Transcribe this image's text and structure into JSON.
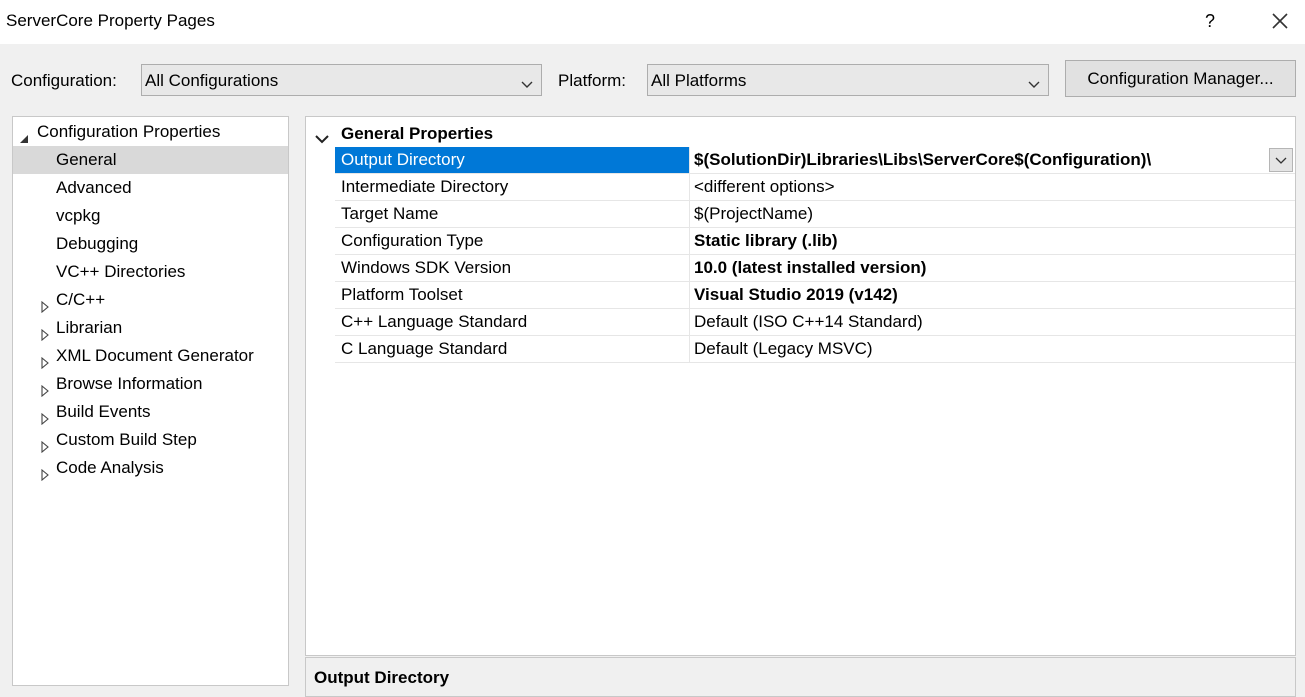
{
  "window": {
    "title": "ServerCore Property Pages",
    "help": "?"
  },
  "toolbar": {
    "configuration_label": "Configuration:",
    "configuration_value": "All Configurations",
    "platform_label": "Platform:",
    "platform_value": "All Platforms",
    "config_manager_label": "Configuration Manager..."
  },
  "tree": {
    "items": [
      {
        "label": "Configuration Properties",
        "expander": "expanded"
      },
      {
        "label": "General",
        "selected": true
      },
      {
        "label": "Advanced"
      },
      {
        "label": "vcpkg"
      },
      {
        "label": "Debugging"
      },
      {
        "label": "VC++ Directories"
      },
      {
        "label": "C/C++",
        "expander": "collapsed"
      },
      {
        "label": "Librarian",
        "expander": "collapsed"
      },
      {
        "label": "XML Document Generator",
        "expander": "collapsed"
      },
      {
        "label": "Browse Information",
        "expander": "collapsed"
      },
      {
        "label": "Build Events",
        "expander": "collapsed"
      },
      {
        "label": "Custom Build Step",
        "expander": "collapsed"
      },
      {
        "label": "Code Analysis",
        "expander": "collapsed"
      }
    ]
  },
  "grid": {
    "group_title": "General Properties",
    "rows": [
      {
        "name": "Output Directory",
        "value": "$(SolutionDir)Libraries\\Libs\\ServerCore$(Configuration)\\",
        "bold": true,
        "selected": true
      },
      {
        "name": "Intermediate Directory",
        "value": "<different options>"
      },
      {
        "name": "Target Name",
        "value": "$(ProjectName)"
      },
      {
        "name": "Configuration Type",
        "value": "Static library (.lib)",
        "bold": true
      },
      {
        "name": "Windows SDK Version",
        "value": "10.0 (latest installed version)",
        "bold": true
      },
      {
        "name": "Platform Toolset",
        "value": "Visual Studio 2019 (v142)",
        "bold": true
      },
      {
        "name": "C++ Language Standard",
        "value": "Default (ISO C++14 Standard)"
      },
      {
        "name": "C Language Standard",
        "value": "Default (Legacy MSVC)"
      }
    ]
  },
  "description": {
    "title": "Output Directory"
  },
  "colors": {
    "selection": "#0078d7",
    "tree_selection": "#d9d9d9"
  }
}
